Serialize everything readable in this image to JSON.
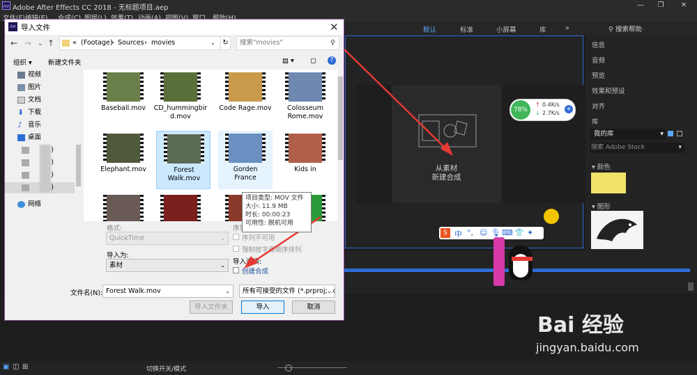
{
  "app": {
    "title": "Adobe After Effects CC 2018 - 无标题项目.aep",
    "logo": "Ae",
    "menus": [
      "文件(F)",
      "编辑(E)",
      "合成(C)",
      "图层(L)",
      "效果(T)",
      "动画(A)",
      "视图(V)",
      "窗口",
      "帮助(H)"
    ],
    "workspaces": [
      "默认",
      "标准",
      "小屏幕",
      "库"
    ],
    "help_search": "搜索帮助",
    "comp_hint": [
      "从素材",
      "新建合成"
    ],
    "right_panel": [
      "信息",
      "音频",
      "预览",
      "效果和预设",
      "对齐",
      "库"
    ],
    "library_name": "我的库",
    "library_search": "搜索 Adobe Stock",
    "library_sections": [
      "颜色",
      "图形"
    ],
    "status_toggle": "切换开关/模式",
    "speed": {
      "percent": "78%",
      "up": "0.4K/s",
      "down": "2.7K/s"
    },
    "watermark": {
      "brand": "Bai 经验",
      "url": "jingyan.baidu.com"
    }
  },
  "dialog": {
    "title": "导入文件",
    "logo": "Ae",
    "path": [
      "«",
      "(Footage)",
      "Sources",
      "movies"
    ],
    "search_placeholder": "搜索\"movies\"",
    "organize": "组织 ▾",
    "new_folder": "新建文件夹",
    "tree": [
      "视频",
      "图片",
      "文档",
      "下载",
      "音乐",
      "桌面",
      ":)",
      ":)",
      ":)",
      ":)",
      "网络"
    ],
    "files": [
      {
        "name": "Baseball.mov",
        "color": "#6b7f4a"
      },
      {
        "name": "CD_hummingbird.mov",
        "color": "#5a6e3a"
      },
      {
        "name": "Code Rage.mov",
        "color": "#c89a4a"
      },
      {
        "name": "Colosseum Rome.mov",
        "color": "#6e88b0"
      },
      {
        "name": "Elephant.mov",
        "color": "#4f5a3a"
      },
      {
        "name": "Forest Walk.mov",
        "color": "#5b6b55"
      },
      {
        "name": "Gorden France",
        "color": "#6a8fc0"
      },
      {
        "name": "Kids in",
        "color": "#b0604a"
      },
      {
        "name": "",
        "color": "#6a5a55"
      },
      {
        "name": "",
        "color": "#7a1e1e"
      },
      {
        "name": "",
        "color": "#8a3a2a"
      },
      {
        "name": "",
        "color": "#2a9a3a"
      }
    ],
    "tooltip": [
      "项目类型: MOV 文件",
      "大小: 11.9 MB",
      "时长: 00:00:23",
      "可用性: 脱机可用"
    ],
    "format_label": "格式:",
    "format_value": "QuickTime",
    "import_as_label": "导入为:",
    "import_as_value": "素材",
    "sequence_label": "序列选项:",
    "sequence_opt1": "序列不可用",
    "sequence_opt2": "强制按字母顺序排列",
    "import_opts_label": "导入选项:",
    "create_comp": "创建合成",
    "filename_label": "文件名(N):",
    "filename_value": "Forest Walk.mov",
    "filetype_value": "所有可接受的文件 (*.prproj;*.c",
    "import_folder": "导入文件夹",
    "import": "导入",
    "cancel": "取消"
  }
}
